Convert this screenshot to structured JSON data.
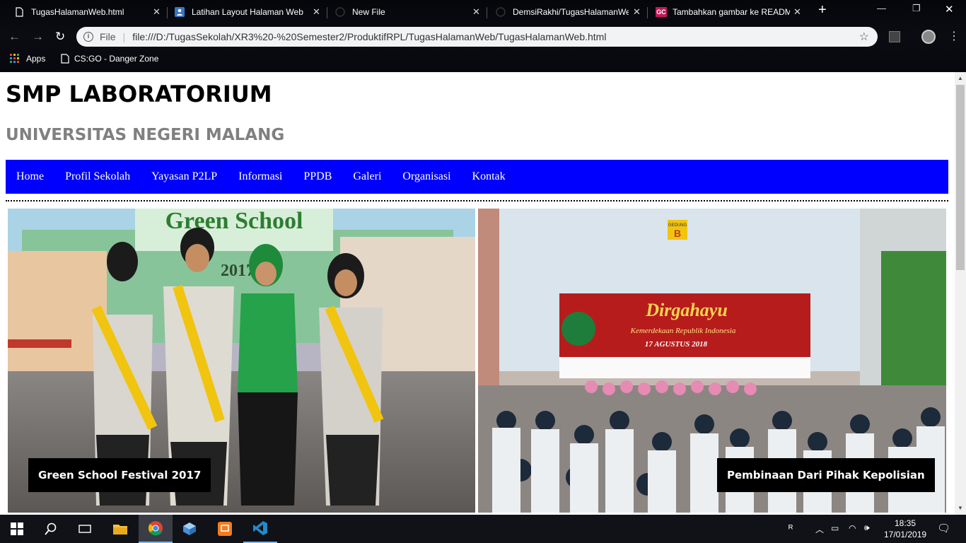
{
  "browser": {
    "tabs": [
      {
        "title": "TugasHalamanWeb.html",
        "icon": "file-icon"
      },
      {
        "title": "Latihan Layout Halaman Web",
        "icon": "person-icon"
      },
      {
        "title": "New File",
        "icon": "github-icon"
      },
      {
        "title": "DemsiRakhi/TugasHalamanWe",
        "icon": "github-icon"
      },
      {
        "title": "Tambahkan gambar ke READM",
        "icon": "gc-icon"
      }
    ],
    "gc_badge": "GC",
    "url_scheme": "File",
    "url": "file:///D:/TugasSekolah/XR3%20-%20Semester2/ProduktifRPL/TugasHalamanWeb/TugasHalamanWeb.html",
    "bookmarks": [
      {
        "label": "Apps",
        "icon": "apps-grid-icon"
      },
      {
        "label": "CS:GO - Danger Zone",
        "icon": "page-icon"
      }
    ]
  },
  "page": {
    "title": "SMP LABORATORIUM",
    "subtitle": "UNIVERSITAS NEGERI MALANG",
    "menu": [
      "Home",
      "Profil Sekolah",
      "Yayasan P2LP",
      "Informasi",
      "PPDB",
      "Galeri",
      "Organisasi",
      "Kontak"
    ],
    "gallery": [
      {
        "caption": "Green School Festival 2017",
        "sign": "Green School",
        "sign_year": "2017"
      },
      {
        "caption": "Pembinaan Dari Pihak Kepolisian",
        "banner_title": "Dirgahayu",
        "banner_sub": "Kemerdekaan Republik Indonesia",
        "banner_date": "17 AGUSTUS 2018",
        "building_label": "GEDUNG",
        "building_letter": "B"
      }
    ]
  },
  "taskbar": {
    "time": "18:35",
    "date": "17/01/2019"
  },
  "colors": {
    "menu_bg": "#0000ff",
    "subtitle": "#808080",
    "caption_bg": "#000000"
  }
}
